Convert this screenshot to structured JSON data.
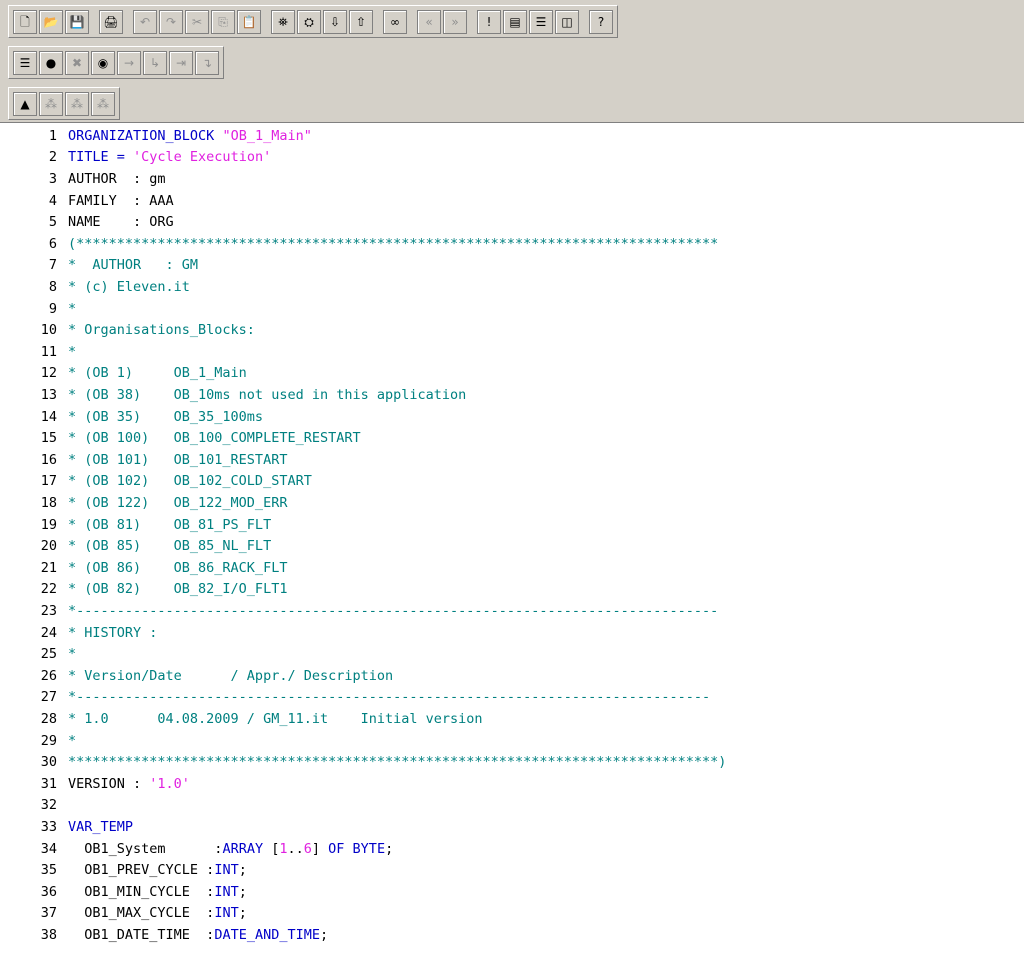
{
  "toolbar_row1": [
    {
      "id": "new",
      "icon": "new-file-icon",
      "glyph": "🗋",
      "enabled": true
    },
    {
      "id": "open",
      "icon": "open-folder-icon",
      "glyph": "📂",
      "enabled": true
    },
    {
      "id": "save",
      "icon": "save-icon",
      "glyph": "💾",
      "enabled": true
    },
    {
      "id": "sep1",
      "sep": true
    },
    {
      "id": "print",
      "icon": "printer-icon",
      "glyph": "🖨",
      "enabled": true
    },
    {
      "id": "sep2",
      "sep": true
    },
    {
      "id": "undo",
      "icon": "undo-icon",
      "glyph": "↶",
      "enabled": false
    },
    {
      "id": "redo",
      "icon": "redo-icon",
      "glyph": "↷",
      "enabled": false
    },
    {
      "id": "cut",
      "icon": "cut-icon",
      "glyph": "✂",
      "enabled": false
    },
    {
      "id": "copy",
      "icon": "copy-icon",
      "glyph": "⎘",
      "enabled": false
    },
    {
      "id": "paste",
      "icon": "paste-icon",
      "glyph": "📋",
      "enabled": true
    },
    {
      "id": "sep3",
      "sep": true
    },
    {
      "id": "find",
      "icon": "find-replace-icon",
      "glyph": "⛯",
      "enabled": true
    },
    {
      "id": "findnext",
      "icon": "find-next-icon",
      "glyph": "⛭",
      "enabled": true
    },
    {
      "id": "download",
      "icon": "download-icon",
      "glyph": "⇩",
      "enabled": true
    },
    {
      "id": "upload",
      "icon": "upload-icon",
      "glyph": "⇧",
      "enabled": true
    },
    {
      "id": "sep4",
      "sep": true
    },
    {
      "id": "monitor",
      "icon": "glasses-icon",
      "glyph": "∞",
      "enabled": true
    },
    {
      "id": "sep5",
      "sep": true
    },
    {
      "id": "prevbm",
      "icon": "previous-bookmark-icon",
      "glyph": "«",
      "enabled": false
    },
    {
      "id": "nextbm",
      "icon": "next-bookmark-icon",
      "glyph": "»",
      "enabled": false
    },
    {
      "id": "sep6",
      "sep": true
    },
    {
      "id": "excl",
      "icon": "exclamation-icon",
      "glyph": "!",
      "enabled": true
    },
    {
      "id": "overview",
      "icon": "overview-window-icon",
      "glyph": "▤",
      "enabled": true
    },
    {
      "id": "splith",
      "icon": "split-horizontal-icon",
      "glyph": "☰",
      "enabled": true
    },
    {
      "id": "splitv",
      "icon": "split-vertical-icon",
      "glyph": "◫",
      "enabled": true
    },
    {
      "id": "sep7",
      "sep": true
    },
    {
      "id": "help",
      "icon": "help-pointer-icon",
      "glyph": "?",
      "enabled": true
    }
  ],
  "toolbar_row2": [
    {
      "id": "list",
      "icon": "list-icon",
      "glyph": "☰",
      "enabled": true
    },
    {
      "id": "bp",
      "icon": "breakpoint-icon",
      "glyph": "●",
      "enabled": true
    },
    {
      "id": "delbp",
      "icon": "delete-breakpoints-icon",
      "glyph": "✖",
      "enabled": false
    },
    {
      "id": "bpact",
      "icon": "breakpoint-active-icon",
      "glyph": "◉",
      "enabled": true
    },
    {
      "id": "nextbp",
      "icon": "next-breakpoint-icon",
      "glyph": "→",
      "enabled": false
    },
    {
      "id": "stepover",
      "icon": "step-over-icon",
      "glyph": "↳",
      "enabled": false
    },
    {
      "id": "stepin",
      "icon": "step-into-icon",
      "glyph": "⇥",
      "enabled": false
    },
    {
      "id": "stepout",
      "icon": "step-out-icon",
      "glyph": "↴",
      "enabled": false
    }
  ],
  "toolbar_row3": [
    {
      "id": "cmp1",
      "icon": "compile-icon",
      "glyph": "▲",
      "enabled": true
    },
    {
      "id": "cmp2",
      "icon": "compile-all-icon",
      "glyph": "⁂",
      "enabled": false
    },
    {
      "id": "cmp3",
      "icon": "compile-changed-icon",
      "glyph": "⁂",
      "enabled": false
    },
    {
      "id": "cmp4",
      "icon": "compile-check-icon",
      "glyph": "⁂",
      "enabled": false
    }
  ],
  "code_lines": [
    {
      "n": "1",
      "segs": [
        {
          "t": "ORGANIZATION_BLOCK ",
          "c": "kw"
        },
        {
          "t": "\"OB_1_Main\"",
          "c": "str"
        }
      ]
    },
    {
      "n": "2",
      "segs": [
        {
          "t": "TITLE = ",
          "c": "kw"
        },
        {
          "t": "'Cycle Execution'",
          "c": "str"
        }
      ]
    },
    {
      "n": "3",
      "segs": [
        {
          "t": "AUTHOR  : gm",
          "c": "plain"
        }
      ]
    },
    {
      "n": "4",
      "segs": [
        {
          "t": "FAMILY  : AAA",
          "c": "plain"
        }
      ]
    },
    {
      "n": "5",
      "segs": [
        {
          "t": "NAME    : ORG",
          "c": "plain"
        }
      ]
    },
    {
      "n": "6",
      "segs": [
        {
          "t": "(*******************************************************************************",
          "c": "cmt"
        }
      ]
    },
    {
      "n": "7",
      "segs": [
        {
          "t": "*  AUTHOR   : GM",
          "c": "cmt"
        }
      ]
    },
    {
      "n": "8",
      "segs": [
        {
          "t": "* (c) Eleven.it",
          "c": "cmt"
        }
      ]
    },
    {
      "n": "9",
      "segs": [
        {
          "t": "*",
          "c": "cmt"
        }
      ]
    },
    {
      "n": "10",
      "segs": [
        {
          "t": "* Organisations_Blocks:",
          "c": "cmt"
        }
      ]
    },
    {
      "n": "11",
      "segs": [
        {
          "t": "*",
          "c": "cmt"
        }
      ]
    },
    {
      "n": "12",
      "segs": [
        {
          "t": "* (OB 1)     OB_1_Main",
          "c": "cmt"
        }
      ]
    },
    {
      "n": "13",
      "segs": [
        {
          "t": "* (OB 38)    OB_10ms not used in this application",
          "c": "cmt"
        }
      ]
    },
    {
      "n": "14",
      "segs": [
        {
          "t": "* (OB 35)    OB_35_100ms",
          "c": "cmt"
        }
      ]
    },
    {
      "n": "15",
      "segs": [
        {
          "t": "* (OB 100)   OB_100_COMPLETE_RESTART",
          "c": "cmt"
        }
      ]
    },
    {
      "n": "16",
      "segs": [
        {
          "t": "* (OB 101)   OB_101_RESTART",
          "c": "cmt"
        }
      ]
    },
    {
      "n": "17",
      "segs": [
        {
          "t": "* (OB 102)   OB_102_COLD_START",
          "c": "cmt"
        }
      ]
    },
    {
      "n": "18",
      "segs": [
        {
          "t": "* (OB 122)   OB_122_MOD_ERR",
          "c": "cmt"
        }
      ]
    },
    {
      "n": "19",
      "segs": [
        {
          "t": "* (OB 81)    OB_81_PS_FLT",
          "c": "cmt"
        }
      ]
    },
    {
      "n": "20",
      "segs": [
        {
          "t": "* (OB 85)    OB_85_NL_FLT",
          "c": "cmt"
        }
      ]
    },
    {
      "n": "21",
      "segs": [
        {
          "t": "* (OB 86)    OB_86_RACK_FLT",
          "c": "cmt"
        }
      ]
    },
    {
      "n": "22",
      "segs": [
        {
          "t": "* (OB 82)    OB_82_I/O_FLT1",
          "c": "cmt"
        }
      ]
    },
    {
      "n": "23",
      "segs": [
        {
          "t": "*-------------------------------------------------------------------------------",
          "c": "cmt"
        }
      ]
    },
    {
      "n": "24",
      "segs": [
        {
          "t": "* HISTORY :",
          "c": "cmt"
        }
      ]
    },
    {
      "n": "25",
      "segs": [
        {
          "t": "*",
          "c": "cmt"
        }
      ]
    },
    {
      "n": "26",
      "segs": [
        {
          "t": "* Version/Date      / Appr./ Description",
          "c": "cmt"
        }
      ]
    },
    {
      "n": "27",
      "segs": [
        {
          "t": "*------------------------------------------------------------------------------",
          "c": "cmt"
        }
      ]
    },
    {
      "n": "28",
      "segs": [
        {
          "t": "* 1.0      04.08.2009 / GM_11.it    Initial version",
          "c": "cmt"
        }
      ]
    },
    {
      "n": "29",
      "segs": [
        {
          "t": "*",
          "c": "cmt"
        }
      ]
    },
    {
      "n": "30",
      "segs": [
        {
          "t": "********************************************************************************)",
          "c": "cmt"
        }
      ]
    },
    {
      "n": "31",
      "segs": [
        {
          "t": "VERSION : ",
          "c": "plain"
        },
        {
          "t": "'1.0'",
          "c": "str"
        }
      ]
    },
    {
      "n": "32",
      "segs": []
    },
    {
      "n": "33",
      "segs": [
        {
          "t": "VAR_TEMP",
          "c": "kw"
        }
      ]
    },
    {
      "n": "34",
      "segs": [
        {
          "t": "  OB1_System      :",
          "c": "plain"
        },
        {
          "t": "ARRAY ",
          "c": "kw"
        },
        {
          "t": "[",
          "c": "plain"
        },
        {
          "t": "1",
          "c": "num"
        },
        {
          "t": "..",
          "c": "plain"
        },
        {
          "t": "6",
          "c": "num"
        },
        {
          "t": "] ",
          "c": "plain"
        },
        {
          "t": "OF BYTE",
          "c": "kw"
        },
        {
          "t": ";",
          "c": "plain"
        }
      ]
    },
    {
      "n": "35",
      "segs": [
        {
          "t": "  OB1_PREV_CYCLE :",
          "c": "plain"
        },
        {
          "t": "INT",
          "c": "kw"
        },
        {
          "t": ";",
          "c": "plain"
        }
      ]
    },
    {
      "n": "36",
      "segs": [
        {
          "t": "  OB1_MIN_CYCLE  :",
          "c": "plain"
        },
        {
          "t": "INT",
          "c": "kw"
        },
        {
          "t": ";",
          "c": "plain"
        }
      ]
    },
    {
      "n": "37",
      "segs": [
        {
          "t": "  OB1_MAX_CYCLE  :",
          "c": "plain"
        },
        {
          "t": "INT",
          "c": "kw"
        },
        {
          "t": ";",
          "c": "plain"
        }
      ]
    },
    {
      "n": "38",
      "segs": [
        {
          "t": "  OB1_DATE_TIME  :",
          "c": "plain"
        },
        {
          "t": "DATE_AND_TIME",
          "c": "kw"
        },
        {
          "t": ";",
          "c": "plain"
        }
      ]
    }
  ]
}
